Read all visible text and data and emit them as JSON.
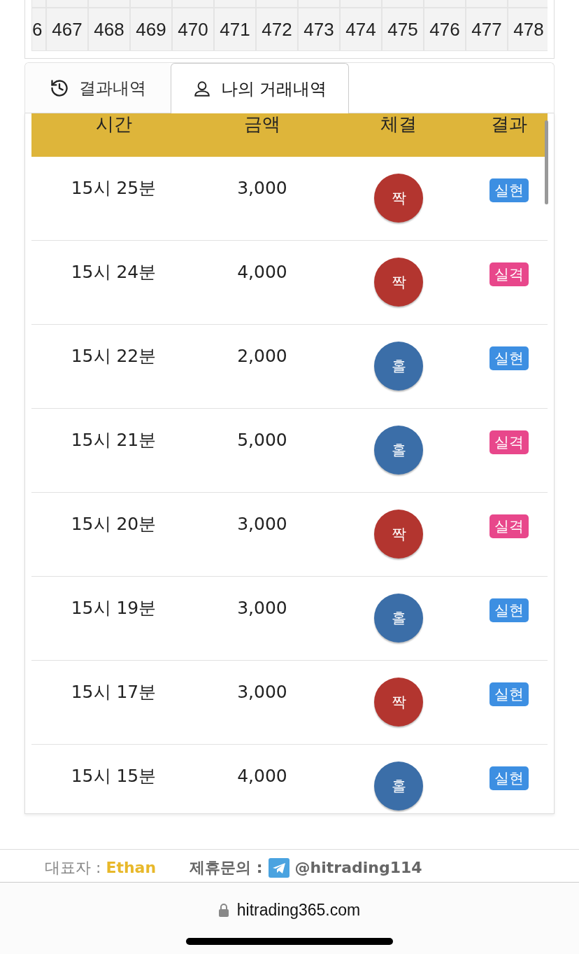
{
  "round_strip": [
    "6",
    "467",
    "468",
    "469",
    "470",
    "471",
    "472",
    "473",
    "474",
    "475",
    "476",
    "477",
    "478"
  ],
  "tabs": [
    {
      "label": "결과내역",
      "selected": false
    },
    {
      "label": "나의 거래내역",
      "selected": true
    }
  ],
  "table": {
    "columns": [
      "시간",
      "금액",
      "체결",
      "결과"
    ],
    "rows": [
      {
        "time": "15시 25분",
        "amount": "3,000",
        "pick": {
          "kind": "even",
          "label": "짝"
        },
        "result": {
          "kind": "win",
          "label": "실현"
        }
      },
      {
        "time": "15시 24분",
        "amount": "4,000",
        "pick": {
          "kind": "even",
          "label": "짝"
        },
        "result": {
          "kind": "lose",
          "label": "실격"
        }
      },
      {
        "time": "15시 22분",
        "amount": "2,000",
        "pick": {
          "kind": "odd",
          "label": "홀"
        },
        "result": {
          "kind": "win",
          "label": "실현"
        }
      },
      {
        "time": "15시 21분",
        "amount": "5,000",
        "pick": {
          "kind": "odd",
          "label": "홀"
        },
        "result": {
          "kind": "lose",
          "label": "실격"
        }
      },
      {
        "time": "15시 20분",
        "amount": "3,000",
        "pick": {
          "kind": "even",
          "label": "짝"
        },
        "result": {
          "kind": "lose",
          "label": "실격"
        }
      },
      {
        "time": "15시 19분",
        "amount": "3,000",
        "pick": {
          "kind": "odd",
          "label": "홀"
        },
        "result": {
          "kind": "win",
          "label": "실현"
        }
      },
      {
        "time": "15시 17분",
        "amount": "3,000",
        "pick": {
          "kind": "even",
          "label": "짝"
        },
        "result": {
          "kind": "win",
          "label": "실현"
        }
      },
      {
        "time": "15시 15분",
        "amount": "4,000",
        "pick": {
          "kind": "odd",
          "label": "홀"
        },
        "result": {
          "kind": "win",
          "label": "실현"
        }
      }
    ]
  },
  "footer": {
    "ceo_label": "대표자 :",
    "ceo_name": "Ethan",
    "contact_label": "제휴문의 :",
    "contact_handle": "@hitrading114"
  },
  "browser_bar": {
    "url": "hitrading365.com"
  }
}
